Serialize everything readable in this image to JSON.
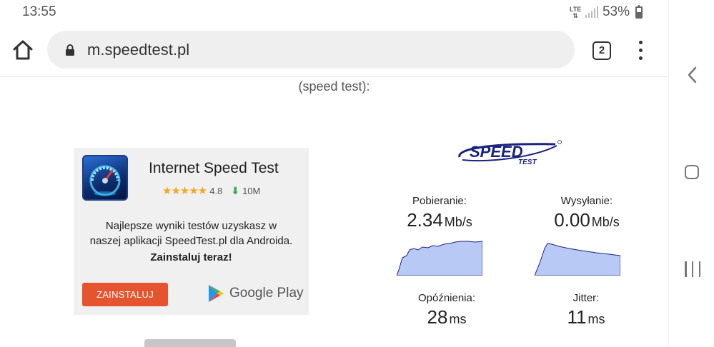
{
  "status_bar": {
    "time": "13:55",
    "network": "LTE",
    "battery_percent": "53%",
    "battery_level": 0.53
  },
  "browser": {
    "url": "m.speedtest.pl",
    "tab_count": "2",
    "icons": {
      "home": "home-icon",
      "lock": "lock-icon",
      "tabs": "tab-switcher-icon",
      "menu": "more-vert-icon"
    }
  },
  "page": {
    "caption": "(speed test):"
  },
  "ad": {
    "title": "Internet Speed Test",
    "rating": "4.8",
    "rating_value": 4.8,
    "downloads": "10M",
    "description_line1": "Najlepsze wyniki testów uzyskasz w",
    "description_line2": "naszej aplikacji SpeedTest.pl dla Androida.",
    "cta": "Zainstaluj teraz!",
    "install_button": "ZAINSTALUJ",
    "store_label": "Google Play",
    "colors": {
      "install_button": "#e4552f",
      "star": "#f5a623",
      "download_arrow": "#3aa757",
      "card_bg": "#f0f0f0"
    }
  },
  "speedtest": {
    "logo_text": "SPEED",
    "logo_subtext": "TEST",
    "logo_color": "#1a237e",
    "graph_fill": "#b8c9f5",
    "download": {
      "label": "Pobieranie:",
      "value": "2.34",
      "unit": "Mb/s"
    },
    "upload": {
      "label": "Wysyłanie:",
      "value": "0.00",
      "unit": "Mb/s"
    },
    "ping": {
      "label": "Opóźnienia:",
      "value": "28",
      "unit": "ms"
    },
    "jitter": {
      "label": "Jitter:",
      "value": "11",
      "unit": "ms"
    }
  },
  "nav_bar": {
    "icons": [
      "back-icon",
      "home-icon",
      "recents-icon"
    ]
  }
}
